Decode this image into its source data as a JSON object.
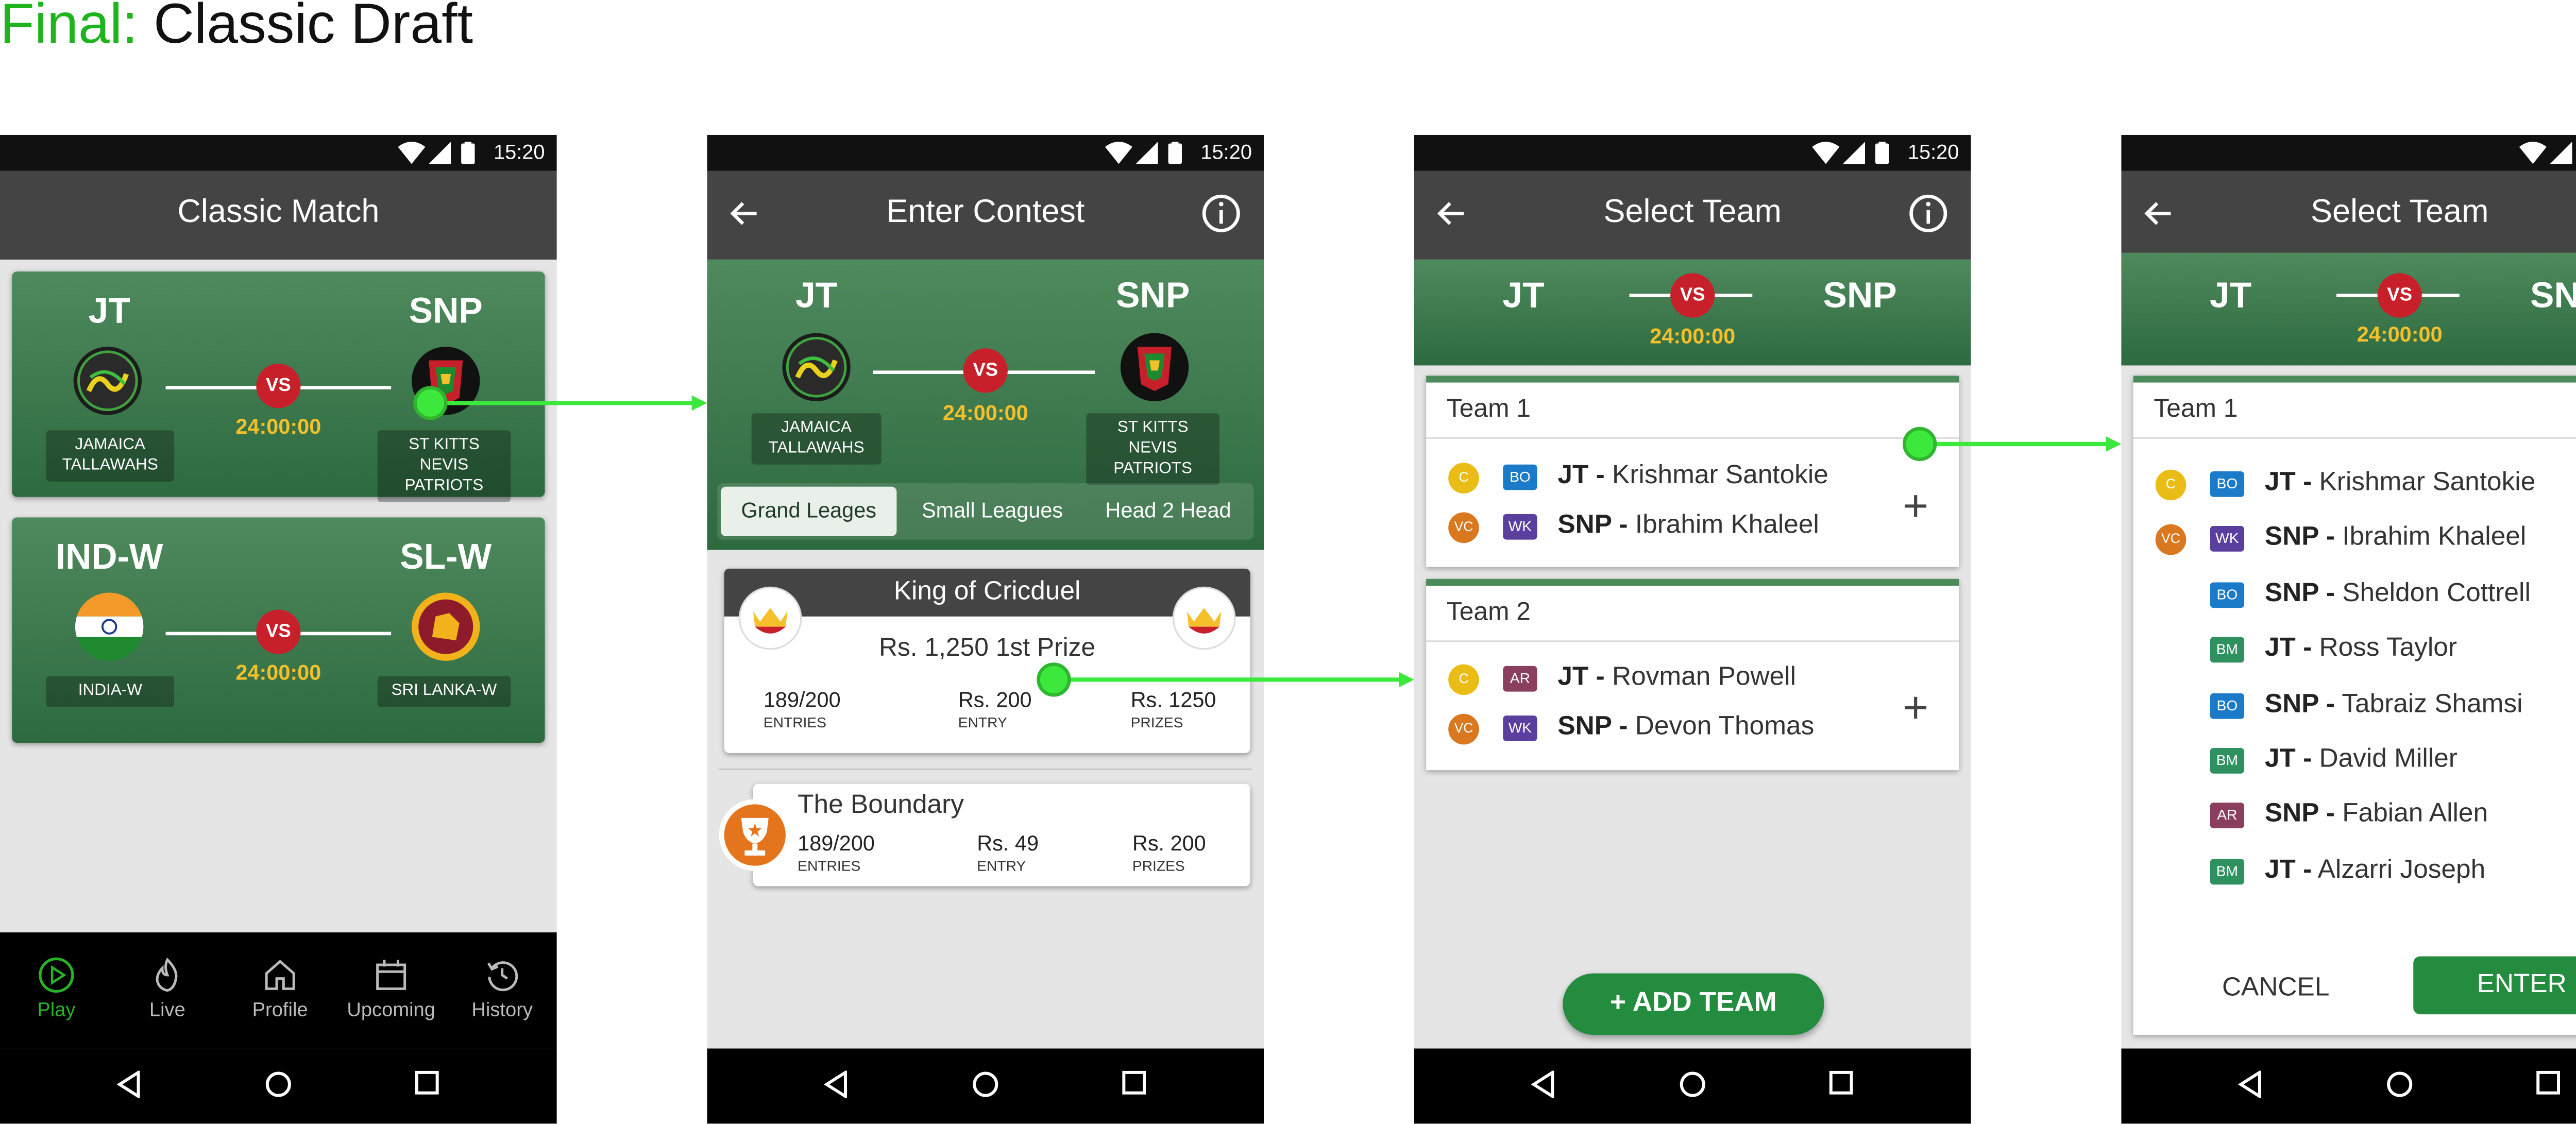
{
  "header": {
    "prefix": "Final:",
    "title": "Classic Draft"
  },
  "status_time": "15:20",
  "colors": {
    "accent": "#26b326",
    "brand_green": "#238c3e",
    "vs_red": "#c8202a",
    "timer": "#f5c02b",
    "connector": "#3ce83c"
  },
  "screen1": {
    "title": "Classic Match",
    "matches": [
      {
        "team_a": "JT",
        "team_b": "SNP",
        "vs": "VS",
        "timer": "24:00:00",
        "name_a": "JAMAICA TALLAWAHS",
        "name_b": "ST KITTS NEVIS PATRIOTS"
      },
      {
        "team_a": "IND-W",
        "team_b": "SL-W",
        "vs": "VS",
        "timer": "24:00:00",
        "name_a": "INDIA-W",
        "name_b": "SRI LANKA-W"
      }
    ],
    "nav": [
      {
        "label": "Play",
        "icon": "play-icon"
      },
      {
        "label": "Live",
        "icon": "flame-icon"
      },
      {
        "label": "Profile",
        "icon": "home-icon"
      },
      {
        "label": "Upcoming",
        "icon": "calendar-icon"
      },
      {
        "label": "History",
        "icon": "history-icon"
      }
    ]
  },
  "screen2": {
    "title": "Enter Contest",
    "match": {
      "team_a": "JT",
      "team_b": "SNP",
      "vs": "VS",
      "timer": "24:00:00",
      "name_a": "JAMAICA TALLAWAHS",
      "name_b": "ST KITTS NEVIS PATRIOTS"
    },
    "tabs": [
      "Grand Leages",
      "Small Leagues",
      "Head 2 Head"
    ],
    "contests": [
      {
        "name": "King of Cricduel",
        "prize": "Rs. 1,250 1st Prize",
        "entries": "189/200",
        "entries_label": "ENTRIES",
        "entry": "Rs. 200",
        "entry_label": "ENTRY",
        "prizes": "Rs. 1250",
        "prizes_label": "PRIZES"
      },
      {
        "name": "The Boundary",
        "entries": "189/200",
        "entries_label": "ENTRIES",
        "entry": "Rs. 49",
        "entry_label": "ENTRY",
        "prizes": "Rs. 200",
        "prizes_label": "PRIZES"
      }
    ]
  },
  "screen3": {
    "title": "Select Team",
    "match": {
      "team_a": "JT",
      "team_b": "SNP",
      "vs": "VS",
      "timer": "24:00:00"
    },
    "teams": [
      {
        "name": "Team 1",
        "players": [
          {
            "cap": "C",
            "role": "BO",
            "team": "JT -",
            "player": "Krishmar Santokie"
          },
          {
            "cap": "VC",
            "role": "WK",
            "team": "SNP -",
            "player": "Ibrahim Khaleel"
          }
        ]
      },
      {
        "name": "Team 2",
        "players": [
          {
            "cap": "C",
            "role": "AR",
            "team": "JT -",
            "player": "Rovman Powell"
          },
          {
            "cap": "VC",
            "role": "WK",
            "team": "SNP -",
            "player": "Devon Thomas"
          }
        ]
      }
    ],
    "add_button": "+ ADD TEAM",
    "plus": "+"
  },
  "screen4": {
    "title": "Select Team",
    "match": {
      "team_a": "JT",
      "team_b": "SNP",
      "vs": "VS",
      "timer": "24:00:00"
    },
    "team_name": "Team 1",
    "players": [
      {
        "cap": "C",
        "role": "BO",
        "team": "JT -",
        "player": "Krishmar Santokie"
      },
      {
        "cap": "VC",
        "role": "WK",
        "team": "SNP -",
        "player": "Ibrahim Khaleel"
      },
      {
        "cap": "",
        "role": "BO",
        "team": "SNP -",
        "player": "Sheldon Cottrell"
      },
      {
        "cap": "",
        "role": "BM",
        "team": "JT -",
        "player": "Ross Taylor"
      },
      {
        "cap": "",
        "role": "BO",
        "team": "SNP -",
        "player": "Tabraiz Shamsi"
      },
      {
        "cap": "",
        "role": "BM",
        "team": "JT -",
        "player": "David Miller"
      },
      {
        "cap": "",
        "role": "AR",
        "team": "SNP -",
        "player": "Fabian Allen"
      },
      {
        "cap": "",
        "role": "BM",
        "team": "JT -",
        "player": "Alzarri Joseph"
      }
    ],
    "cancel": "CANCEL",
    "enter": "ENTER"
  }
}
